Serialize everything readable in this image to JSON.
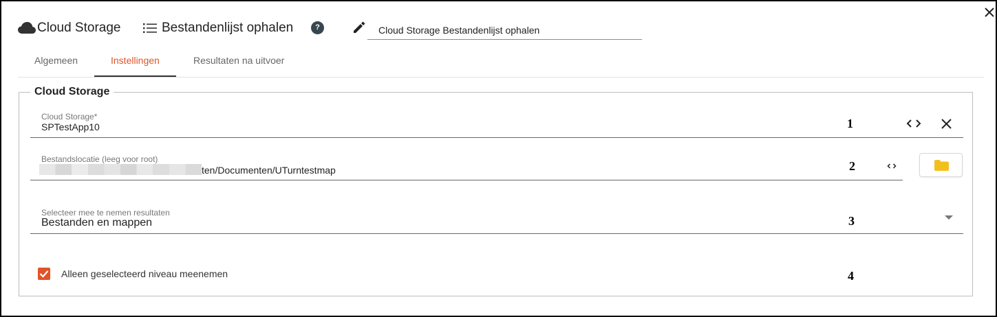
{
  "header": {
    "connector_title": "Cloud Storage",
    "action_title": "Bestandenlijst ophalen",
    "help_label": "?",
    "name_value": "Cloud Storage Bestandenlijst ophalen"
  },
  "tabs": [
    {
      "label": "Algemeen",
      "active": false
    },
    {
      "label": "Instellingen",
      "active": true
    },
    {
      "label": "Resultaten na uitvoer",
      "active": false
    }
  ],
  "section": {
    "legend": "Cloud Storage",
    "cloud_storage": {
      "label": "Cloud Storage*",
      "value": "SPTestApp10",
      "marker": "1"
    },
    "location": {
      "label": "Bestandslocatie (leeg voor root)",
      "value_visible": "ten/Documenten/UTurntestmap",
      "marker": "2"
    },
    "results": {
      "label": "Selecteer mee te nemen resultaten",
      "value": "Bestanden en mappen",
      "marker": "3"
    },
    "checkbox": {
      "label": "Alleen geselecteerd niveau meenemen",
      "checked": true,
      "marker": "4"
    }
  },
  "colors": {
    "accent": "#e0542a",
    "folder": "#f2c01e",
    "help_bg": "#37474f"
  }
}
